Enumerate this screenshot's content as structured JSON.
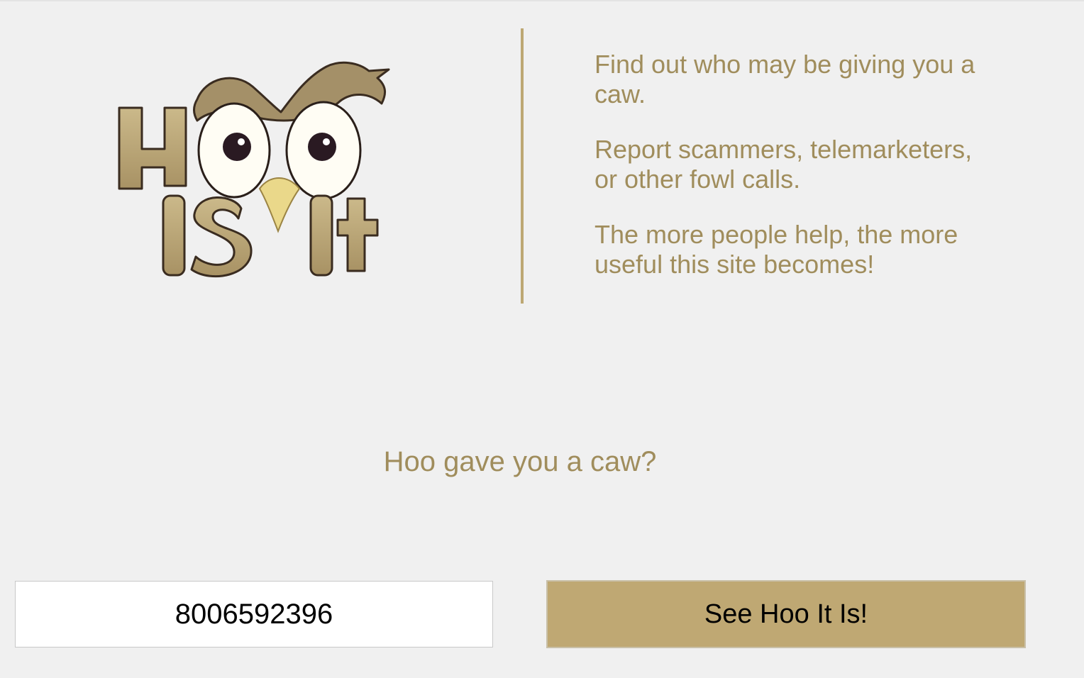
{
  "brand": {
    "logo_text": "Hoo Is It",
    "logo_icon": "owl-icon",
    "gold": "#bda873",
    "text_gold": "#a08d5c"
  },
  "intro": {
    "line1": "Find out who may be giving you a caw.",
    "line2": "Report scammers, telemarketers, or other fowl calls.",
    "line3": "The more people help, the more useful this site becomes!"
  },
  "lookup": {
    "question": "Hoo gave you a caw?",
    "phone_value": "8006592396",
    "submit_label": "See Hoo It Is!"
  }
}
